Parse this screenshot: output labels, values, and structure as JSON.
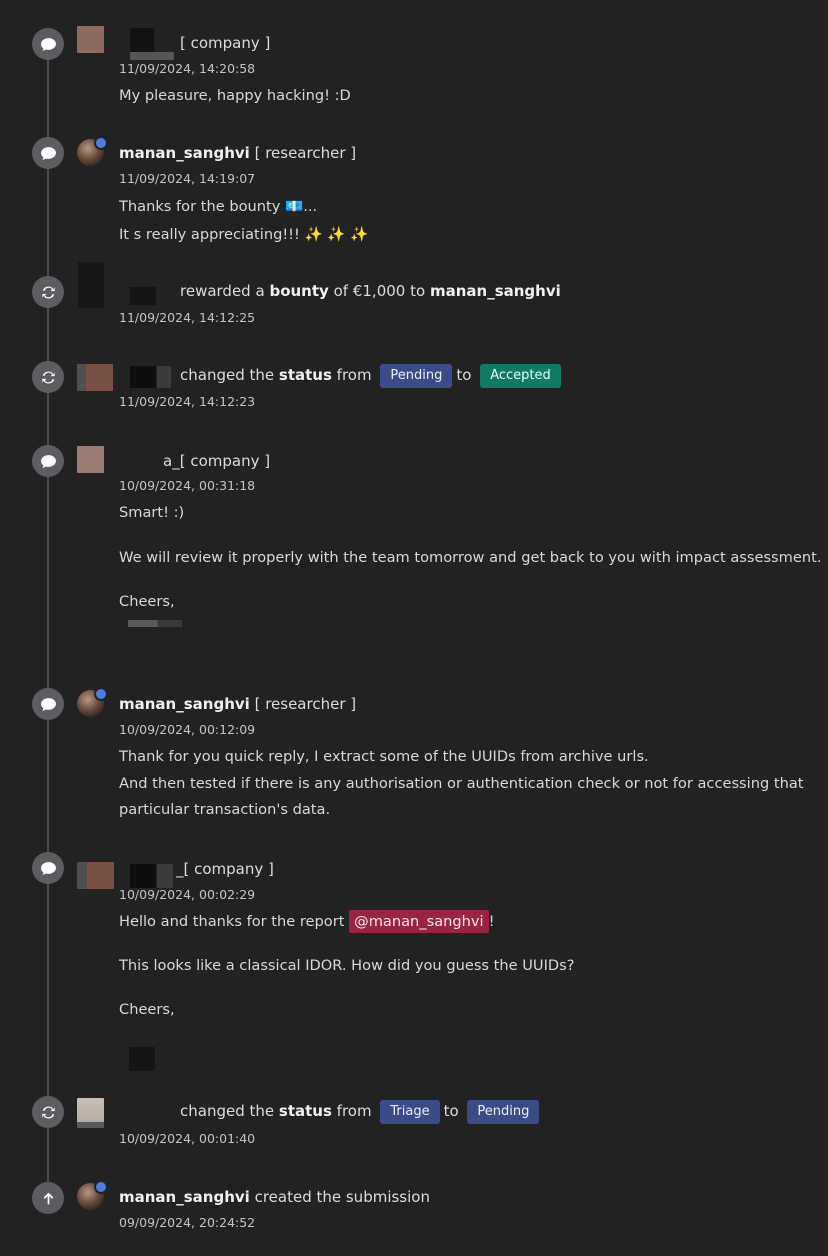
{
  "timeline": [
    {
      "type": "comment",
      "author_tag": "[ company ]",
      "timestamp": "11/09/2024, 14:20:58",
      "lines": [
        "My pleasure, happy hacking! :D"
      ]
    },
    {
      "type": "comment",
      "author": "manan_sanghvi",
      "author_tag": "[ researcher ]",
      "timestamp": "11/09/2024, 14:19:07",
      "lines": [
        "Thanks for the bounty 💶...",
        "It s really appreciating!!! ✨ ✨ ✨"
      ]
    },
    {
      "type": "reward",
      "text_rewarded": "rewarded a",
      "text_bounty": "bounty",
      "text_of": "of",
      "amount": "€1,000",
      "text_to": "to",
      "recipient": "manan_sanghvi",
      "timestamp": "11/09/2024, 14:12:25"
    },
    {
      "type": "status_change",
      "text_changed": "changed the",
      "text_status": "status",
      "text_from": "from",
      "from_status": "Pending",
      "text_to": "to",
      "to_status": "Accepted",
      "timestamp": "11/09/2024, 14:12:23"
    },
    {
      "type": "comment",
      "author_fragment": "a",
      "author_tag": "_[ company ]",
      "timestamp": "10/09/2024, 00:31:18",
      "lines": [
        "Smart! :)",
        "We will review it properly with the team tomorrow and get back to you with impact assessment.",
        "Cheers,"
      ]
    },
    {
      "type": "comment",
      "author": "manan_sanghvi",
      "author_tag": "[ researcher ]",
      "timestamp": "10/09/2024, 00:12:09",
      "lines": [
        "Thank for you quick reply, I extract some of the UUIDs from archive urls.",
        "And then tested if there is any authorisation or authentication check or not for accessing that",
        "particular transaction's data."
      ]
    },
    {
      "type": "comment",
      "author_tag": "_[ company ]",
      "timestamp": "10/09/2024, 00:02:29",
      "greeting": "Hello and thanks for the report",
      "mention": "@manan_sanghvi",
      "greeting_end": "!",
      "lines": [
        "This looks like a classical IDOR. How did you guess the UUIDs?",
        "Cheers,"
      ]
    },
    {
      "type": "status_change",
      "text_changed": "changed the",
      "text_status": "status",
      "text_from": "from",
      "from_status": "Triage",
      "text_to": "to",
      "to_status": "Pending",
      "timestamp": "10/09/2024, 00:01:40"
    },
    {
      "type": "created",
      "author": "manan_sanghvi",
      "text": "created the submission",
      "timestamp": "09/09/2024, 20:24:52"
    }
  ],
  "colors": {
    "background": "#222223",
    "badge_blue": "#3a4b87",
    "badge_green": "#117a64",
    "mention": "#9a2342",
    "event_icon": "#5c5d60"
  },
  "icons": [
    "comment-icon",
    "status-change-icon",
    "created-arrow-icon"
  ]
}
